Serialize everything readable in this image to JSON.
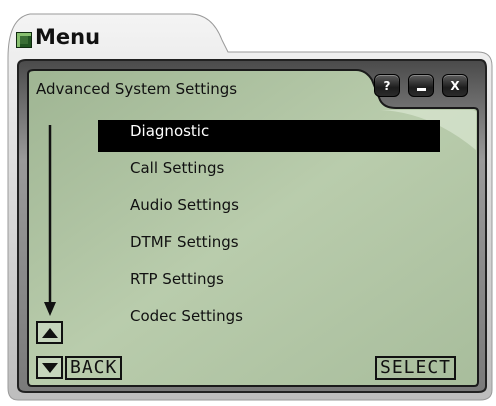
{
  "window": {
    "title": "Menu",
    "icon": "menu-window-icon",
    "controls": {
      "help_label": "?",
      "minimize_icon": "minimize-icon",
      "close_label": "X"
    }
  },
  "screen": {
    "title": "Advanced System Settings",
    "items": [
      {
        "label": "Diagnostic",
        "selected": true
      },
      {
        "label": "Call Settings",
        "selected": false
      },
      {
        "label": "Audio Settings",
        "selected": false
      },
      {
        "label": "DTMF Settings",
        "selected": false
      },
      {
        "label": "RTP Settings",
        "selected": false
      },
      {
        "label": "Codec Settings",
        "selected": false
      }
    ],
    "scroll_up_icon": "triangle-up-icon",
    "scroll_down_icon": "triangle-down-icon",
    "back_label": "BACK",
    "select_label": "SELECT"
  },
  "colors": {
    "lcd_green": "#b3c8a6",
    "frame_dark": "#1e1e1e",
    "frame_grey": "#8f8f8f",
    "selection": "#000000"
  }
}
